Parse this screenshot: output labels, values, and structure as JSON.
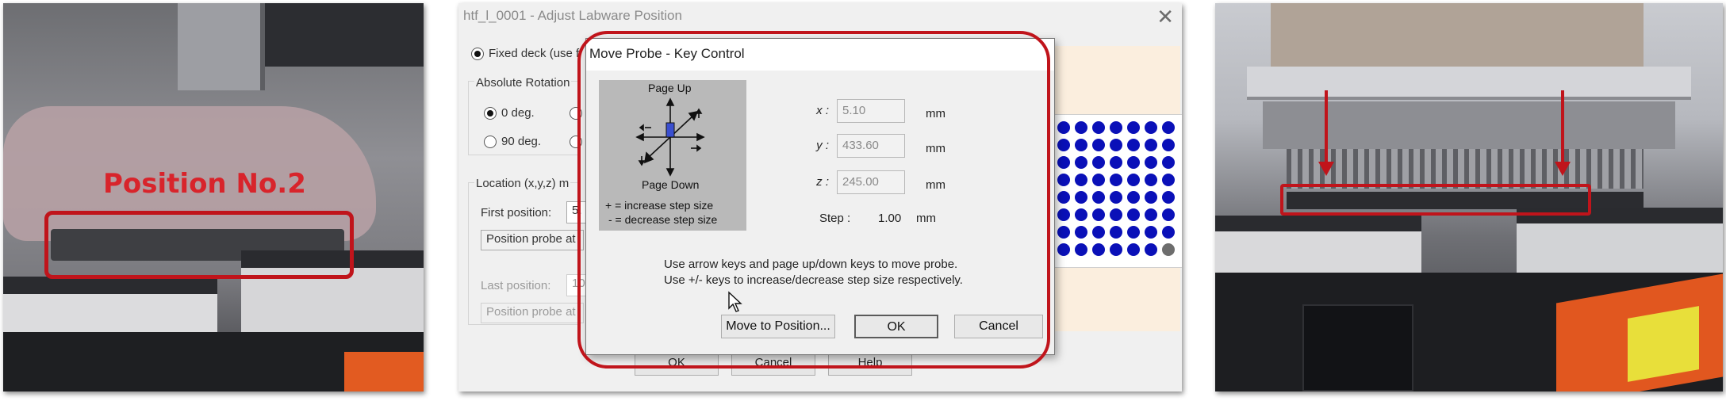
{
  "photo_left": {
    "label": "Position No.2",
    "highlight_color": "#c0141b"
  },
  "screen": {
    "window_title": "htf_l_0001 - Adjust Labware Position",
    "close_icon": "close-icon",
    "background": {
      "fixed_deck": "Fixed deck (use f",
      "absolute_rotation": "Absolute Rotation",
      "rot_0": "0 deg.",
      "rot_90": "90 deg.",
      "location": "Location (x,y,z) m",
      "first_position": "First position:",
      "first_value": "5.",
      "position_probe_1": "Position probe at",
      "last_position": "Last position:",
      "last_value": "10",
      "position_probe_2": "Position probe at",
      "ok": "OK",
      "cancel": "Cancel",
      "help": "Help"
    },
    "dialog": {
      "title": "Move Probe - Key Control",
      "page_up": "Page Up",
      "page_down": "Page Down",
      "increase_hint": "+ = increase step size",
      "decrease_hint": "- = decrease step size",
      "x_label": "x :",
      "x_value": "5.10",
      "y_label": "y :",
      "y_value": "433.60",
      "z_label": "z :",
      "z_value": "245.00",
      "unit": "mm",
      "step_label": "Step :",
      "step_value": "1.00",
      "instructions_line1": "Use arrow keys and page up/down keys to move probe.",
      "instructions_line2": "Use +/- keys to increase/decrease step size respectively.",
      "move_to_position": "Move to Position...",
      "ok": "OK",
      "cancel": "Cancel"
    },
    "well_color": "#0a10b8"
  },
  "photo_right": {
    "highlight_color": "#c0141b"
  }
}
